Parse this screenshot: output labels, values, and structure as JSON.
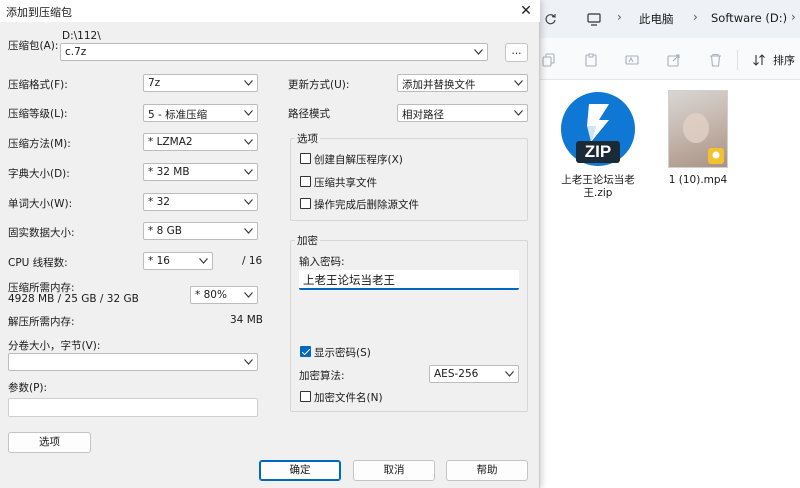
{
  "dialog": {
    "title": "添加到压缩包",
    "archive": {
      "label": "压缩包(A):",
      "path": "D:\\112\\",
      "filename": "c.7z",
      "browse_label": "..."
    },
    "left": {
      "format": {
        "label": "压缩格式(F):",
        "value": "7z"
      },
      "level": {
        "label": "压缩等级(L):",
        "value": "5 - 标准压缩"
      },
      "method": {
        "label": "压缩方法(M):",
        "value": "* LZMA2"
      },
      "dict": {
        "label": "字典大小(D):",
        "value": "* 32 MB"
      },
      "word": {
        "label": "单词大小(W):",
        "value": "* 32"
      },
      "solid": {
        "label": "固实数据大小:",
        "value": "* 8 GB"
      },
      "threads": {
        "label": "CPU 线程数:",
        "value": "* 16",
        "max": "/ 16"
      },
      "memory": {
        "label": "压缩所需内存:",
        "detail": "4928 MB / 25 GB / 32 GB",
        "value": "* 80%"
      },
      "decomp": {
        "label": "解压所需内存:",
        "value": "34 MB"
      },
      "split": {
        "label": "分卷大小，字节(V):",
        "value": ""
      },
      "params": {
        "label": "参数(P):",
        "value": ""
      },
      "options_button": "选项"
    },
    "right": {
      "update": {
        "label": "更新方式(U):",
        "value": "添加并替换文件"
      },
      "pathmode": {
        "label": "路径模式",
        "value": "相对路径"
      },
      "options_group": {
        "title": "选项",
        "sfx": {
          "label": "创建自解压程序(X)",
          "checked": false
        },
        "shared": {
          "label": "压缩共享文件",
          "checked": false
        },
        "delete": {
          "label": "操作完成后删除源文件",
          "checked": false
        }
      },
      "encryption": {
        "title": "加密",
        "password_label": "输入密码:",
        "password_value": "上老王论坛当老王",
        "show_password": {
          "label": "显示密码(S)",
          "checked": true
        },
        "method_label": "加密算法:",
        "method_value": "AES-256",
        "encrypt_names": {
          "label": "加密文件名(N)",
          "checked": false
        }
      }
    },
    "buttons": {
      "ok": "确定",
      "cancel": "取消",
      "help": "帮助"
    }
  },
  "explorer": {
    "breadcrumb": [
      "此电脑",
      "Software (D:)"
    ],
    "sort_label": "排序",
    "files": [
      {
        "name": "上老王论坛当老王.zip",
        "icon": "zip-file-icon",
        "badge": "ZIP"
      },
      {
        "name": "1 (10).mp4",
        "icon": "video-thumbnail"
      }
    ]
  },
  "colors": {
    "accent": "#0067c0",
    "zip_blue": "#0f78d4"
  }
}
